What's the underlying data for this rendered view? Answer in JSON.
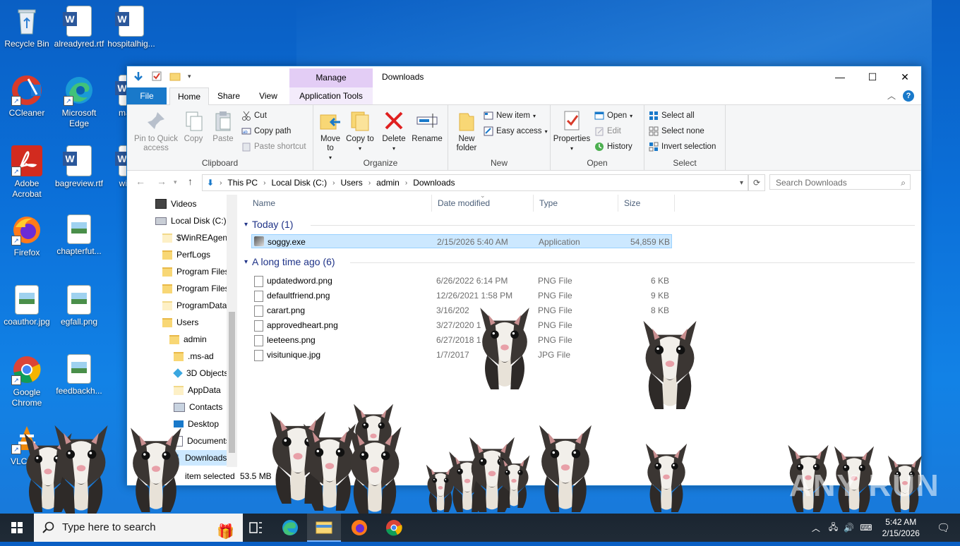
{
  "desktop": {
    "icons": [
      {
        "label": "Recycle Bin",
        "icon": "recycle-bin-icon"
      },
      {
        "label": "alreadyred.rtf",
        "icon": "word-doc-icon"
      },
      {
        "label": "hospitalhig...",
        "icon": "word-doc-icon"
      },
      {
        "label": "CCleaner",
        "icon": "ccleaner-icon"
      },
      {
        "label": "Microsoft Edge",
        "icon": "edge-icon"
      },
      {
        "label": "male...",
        "icon": "word-doc-icon"
      },
      {
        "label": "Adobe Acrobat",
        "icon": "acrobat-icon"
      },
      {
        "label": "bagreview.rtf",
        "icon": "word-doc-icon"
      },
      {
        "label": "wine...",
        "icon": "word-doc-icon"
      },
      {
        "label": "Firefox",
        "icon": "firefox-icon"
      },
      {
        "label": "chapterfut...",
        "icon": "image-file-icon"
      },
      {
        "label": "coauthor.jpg",
        "icon": "image-file-icon"
      },
      {
        "label": "egfall.png",
        "icon": "image-file-icon"
      },
      {
        "label": "Google Chrome",
        "icon": "chrome-icon"
      },
      {
        "label": "feedbackh...",
        "icon": "image-file-icon"
      },
      {
        "label": "VLC pl...",
        "icon": "vlc-icon"
      }
    ]
  },
  "explorer": {
    "title": "Downloads",
    "context_tab": "Manage",
    "tabs": {
      "file": "File",
      "home": "Home",
      "share": "Share",
      "view": "View",
      "app_tools": "Application Tools"
    },
    "ribbon": {
      "clipboard": {
        "label": "Clipboard",
        "pin": "Pin to Quick access",
        "copy": "Copy",
        "paste": "Paste",
        "cut": "Cut",
        "copy_path": "Copy path",
        "paste_shortcut": "Paste shortcut"
      },
      "organize": {
        "label": "Organize",
        "move_to": "Move to",
        "copy_to": "Copy to",
        "delete": "Delete",
        "rename": "Rename"
      },
      "new": {
        "label": "New",
        "new_folder": "New folder",
        "new_item": "New item",
        "easy_access": "Easy access"
      },
      "open": {
        "label": "Open",
        "properties": "Properties",
        "open": "Open",
        "edit": "Edit",
        "history": "History"
      },
      "select": {
        "label": "Select",
        "select_all": "Select all",
        "select_none": "Select none",
        "invert": "Invert selection"
      }
    },
    "address": {
      "crumbs": [
        "This PC",
        "Local Disk (C:)",
        "Users",
        "admin",
        "Downloads"
      ],
      "search_placeholder": "Search Downloads"
    },
    "nav": [
      {
        "label": "Videos",
        "icon": "videos-icon"
      },
      {
        "label": "Local Disk (C:)",
        "icon": "drive-icon"
      },
      {
        "label": "$WinREAgent",
        "icon": "folder-icon"
      },
      {
        "label": "PerfLogs",
        "icon": "folder-icon"
      },
      {
        "label": "Program Files",
        "icon": "folder-icon"
      },
      {
        "label": "Program Files",
        "icon": "folder-icon"
      },
      {
        "label": "ProgramData",
        "icon": "folder-icon"
      },
      {
        "label": "Users",
        "icon": "folder-icon"
      },
      {
        "label": "admin",
        "icon": "folder-icon"
      },
      {
        "label": ".ms-ad",
        "icon": "folder-icon"
      },
      {
        "label": "3D Objects",
        "icon": "3d-objects-icon"
      },
      {
        "label": "AppData",
        "icon": "folder-icon"
      },
      {
        "label": "Contacts",
        "icon": "contacts-icon"
      },
      {
        "label": "Desktop",
        "icon": "desktop-icon"
      },
      {
        "label": "Documents",
        "icon": "documents-icon"
      },
      {
        "label": "Downloads",
        "icon": "downloads-icon"
      }
    ],
    "columns": {
      "name": "Name",
      "date": "Date modified",
      "type": "Type",
      "size": "Size"
    },
    "groups": [
      {
        "label": "Today (1)",
        "files": [
          {
            "name": "soggy.exe",
            "date": "2/15/2026 5:40 AM",
            "type": "Application",
            "size": "54,859 KB",
            "selected": true
          }
        ]
      },
      {
        "label": "A long time ago (6)",
        "files": [
          {
            "name": "updatedword.png",
            "date": "6/26/2022 6:14 PM",
            "type": "PNG File",
            "size": "6 KB"
          },
          {
            "name": "defaultfriend.png",
            "date": "12/26/2021 1:58 PM",
            "type": "PNG File",
            "size": "9 KB"
          },
          {
            "name": "carart.png",
            "date": "3/16/202",
            "type": "PNG File",
            "size": "8 KB"
          },
          {
            "name": "approvedheart.png",
            "date": "3/27/2020 1",
            "type": "PNG File",
            "size": ""
          },
          {
            "name": "leeteens.png",
            "date": "6/27/2018 1",
            "type": "PNG File",
            "size": ""
          },
          {
            "name": "visitunique.jpg",
            "date": "1/7/2017",
            "type": "JPG File",
            "size": ""
          }
        ]
      }
    ],
    "status": {
      "selected": "item selected",
      "size": "53.5 MB"
    }
  },
  "taskbar": {
    "search_placeholder": "Type here to search",
    "time": "5:42 AM",
    "date": "2/15/2026"
  },
  "watermark": "ANY RUN",
  "colors": {
    "accent": "#1979ca",
    "selection": "#cce8ff",
    "manage": "#e3cdf5"
  }
}
